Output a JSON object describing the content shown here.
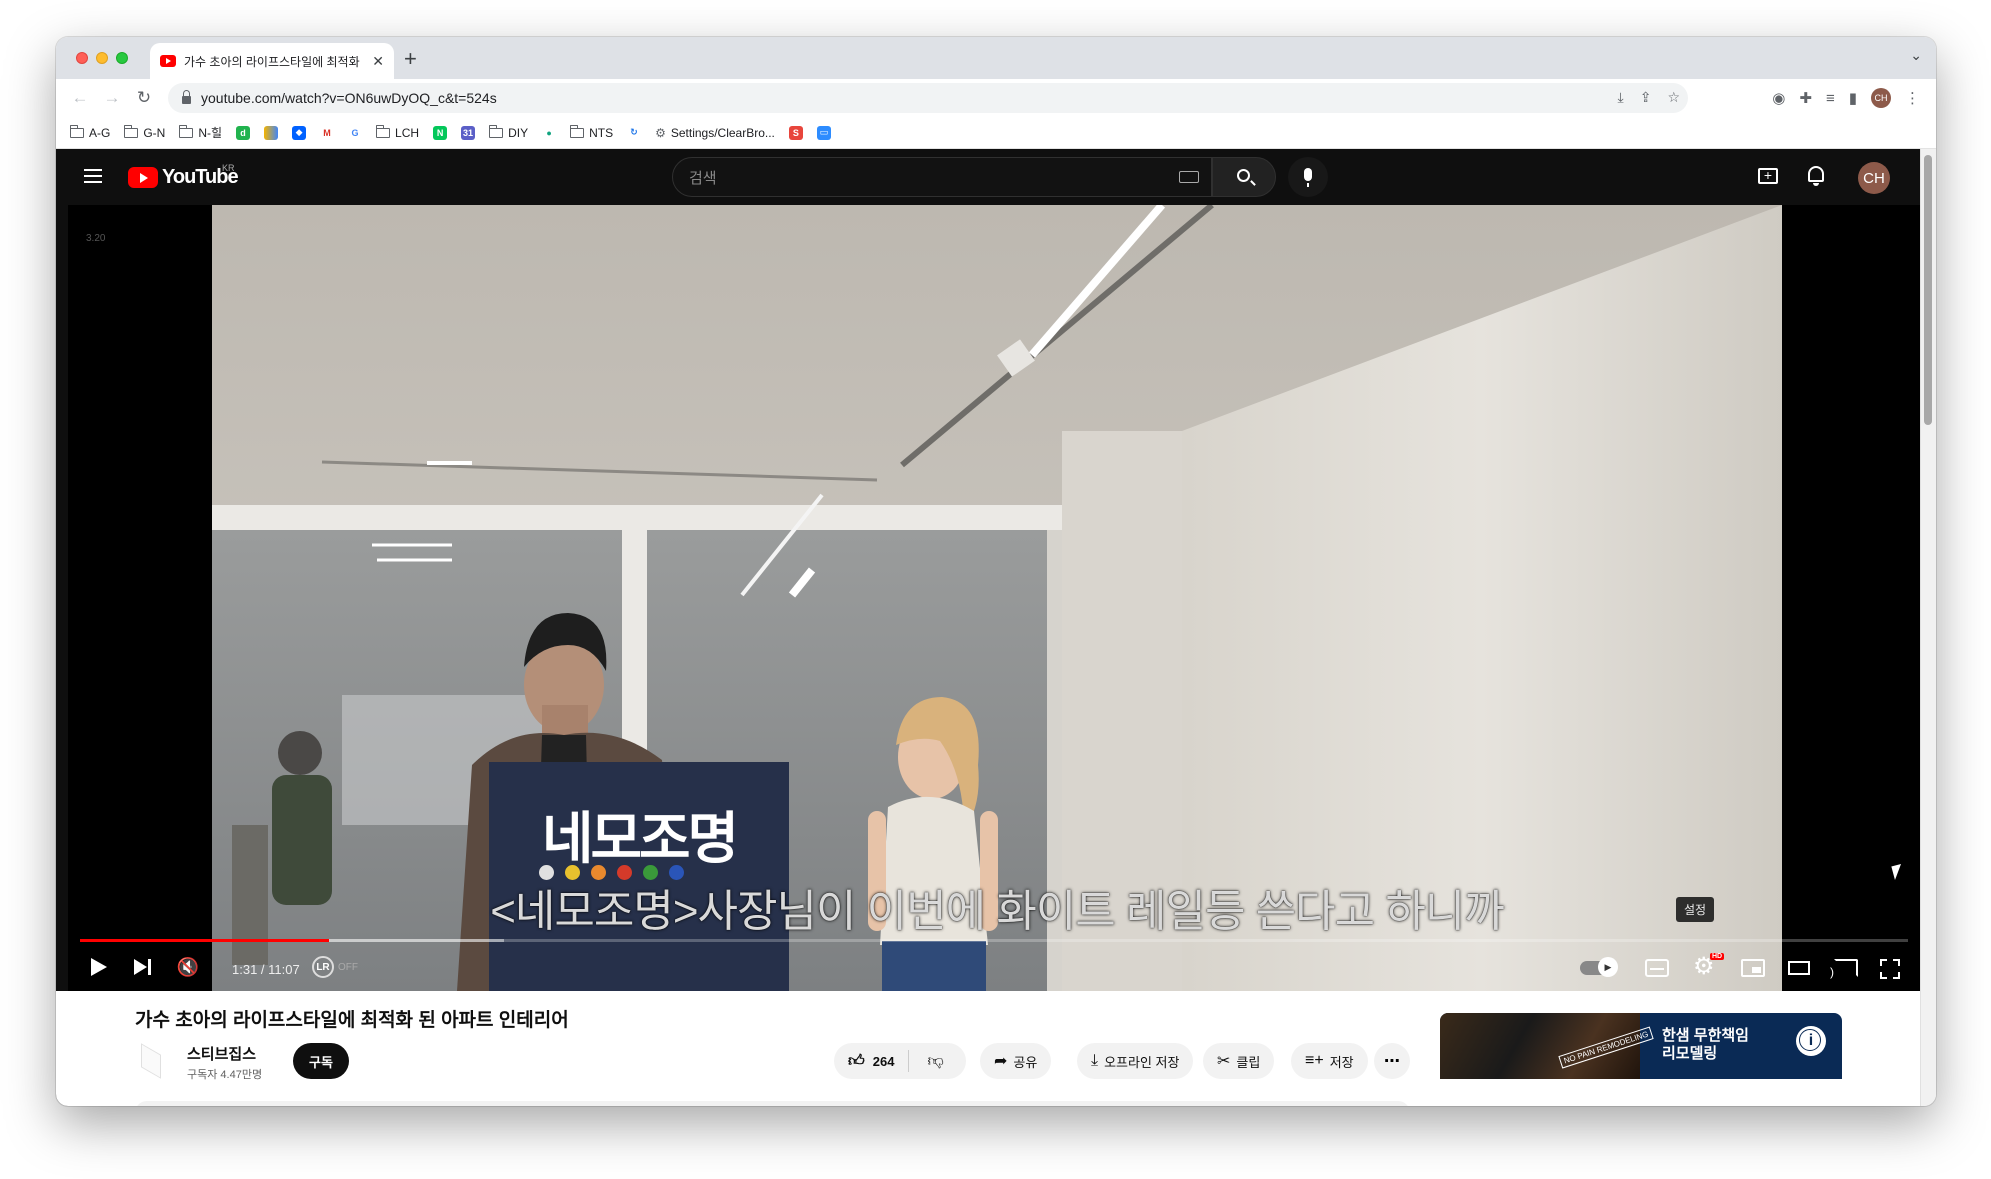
{
  "browser": {
    "tab_title": "가수 초아의 라이프스타일에 최적화",
    "url": "youtube.com/watch?v=ON6uwDyOQ_c&t=524s",
    "bookmarks": [
      "A-G",
      "G-N",
      "N-힐",
      "LCH",
      "DIY",
      "NTS",
      "Settings/ClearBro..."
    ],
    "profile_initials": "CH"
  },
  "youtube": {
    "country": "KR",
    "search_placeholder": "검색",
    "avatar_initials": "CH",
    "side_label": "3.20"
  },
  "player": {
    "subtitle": "<네모조명>사장님이 이번에 화이트 레일등 쓴다고 하니까",
    "sign_text": "네모조명",
    "sign_dot_colors": [
      "#e0e0e0",
      "#e8c12e",
      "#e8892e",
      "#d43a2a",
      "#3a9a3a",
      "#2a55b8"
    ],
    "time": "1:31 / 11:07",
    "lr_badge": "LR",
    "lr_state": "OFF",
    "hd_badge": "HD",
    "settings_tooltip": "설정",
    "progress_fraction": 0.136,
    "buffer_fraction": 0.232
  },
  "video": {
    "title": "가수 초아의 라이프스타일에 최적화 된 아파트 인테리어",
    "channel_name": "스티브집스",
    "subscribers": "구독자 4.47만명",
    "subscribe_label": "구독",
    "like_count": "264",
    "share_label": "공유",
    "download_label": "오프라인 저장",
    "clip_label": "클립",
    "save_label": "저장"
  },
  "ad": {
    "headline_line1": "한샘 무한책임",
    "headline_line2": "리모델링",
    "stamp": "NO PAIN REMODELING"
  },
  "colors": {
    "yt_red": "#ff0000",
    "dark_bg": "#0f0f0f"
  }
}
